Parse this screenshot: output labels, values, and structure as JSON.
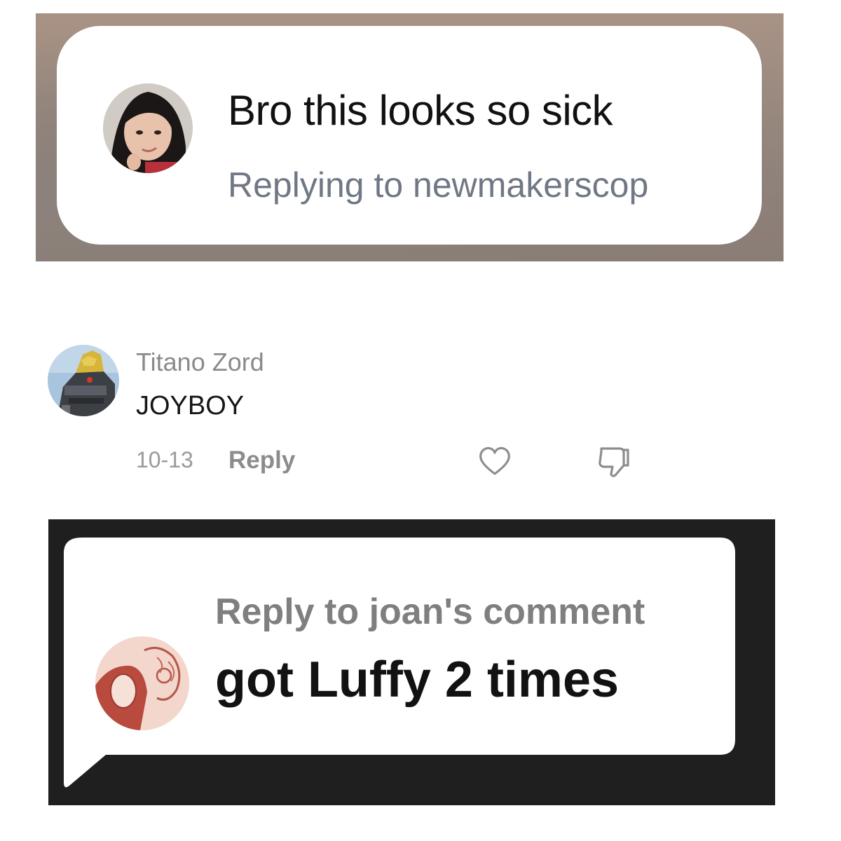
{
  "reply_notice": {
    "message": "Bro this looks so sick",
    "replying_to": "Replying to newmakerscop"
  },
  "comment": {
    "username": "Titano Zord",
    "text": "JOYBOY",
    "date": "10-13",
    "reply_label": "Reply"
  },
  "reply_sticker": {
    "header": "Reply to joan's comment",
    "text": "got Luffy 2 times"
  },
  "icons": {
    "like": "heart-outline-icon",
    "dislike": "thumbs-down-outline-icon"
  },
  "colors": {
    "secondary_text": "#6f7884",
    "muted_text": "#8a8a8a",
    "sticker_background": "#1f1f1f"
  }
}
